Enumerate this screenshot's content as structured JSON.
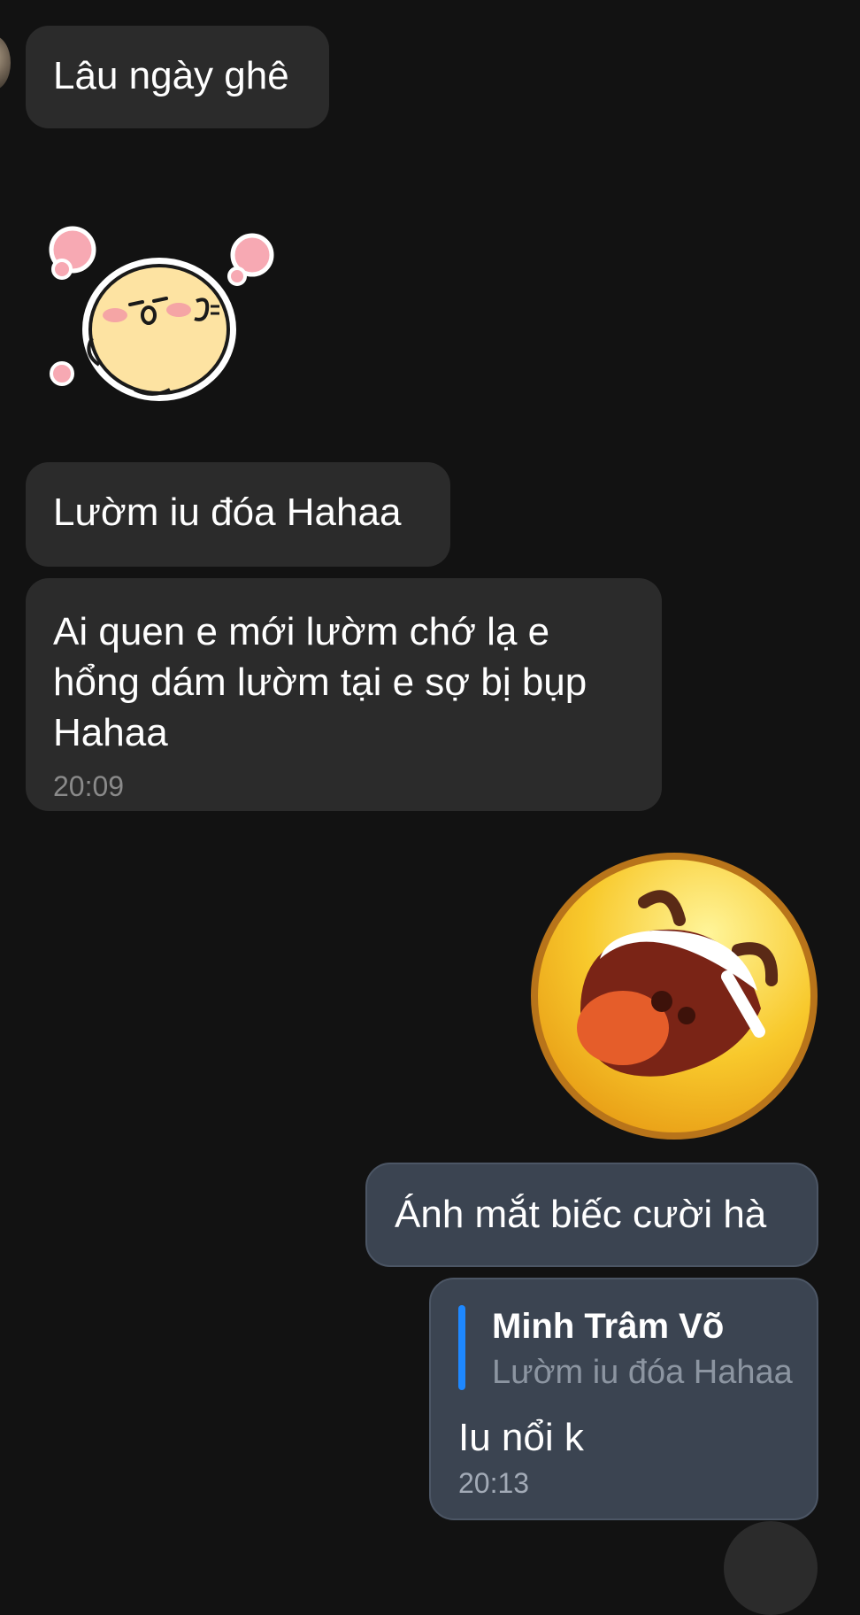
{
  "messages": {
    "m1": {
      "text": "Lâu ngày ghê"
    },
    "m2": {
      "text": "Lườm iu đóa Hahaa"
    },
    "m3": {
      "text": "Ai quen e mới lườm chớ lạ e hổng dám lườm tại e sợ bị bụp Hahaa",
      "time": "20:09"
    },
    "m4": {
      "text": "Ánh mắt biếc cười hà"
    },
    "m5": {
      "reply_to": {
        "name": "Minh Trâm Võ",
        "text": "Lườm iu đóa Hahaa"
      },
      "text": "Iu nổi k",
      "time": "20:13"
    }
  },
  "stickers": {
    "incoming": "chick-sticker-icon",
    "outgoing": "laughing-emoji-icon"
  },
  "colors": {
    "background": "#121212",
    "bubble_in": "#2b2b2b",
    "bubble_out": "#3b4451",
    "quote_bar": "#1e88ff",
    "time_text": "#8a8a8a"
  }
}
